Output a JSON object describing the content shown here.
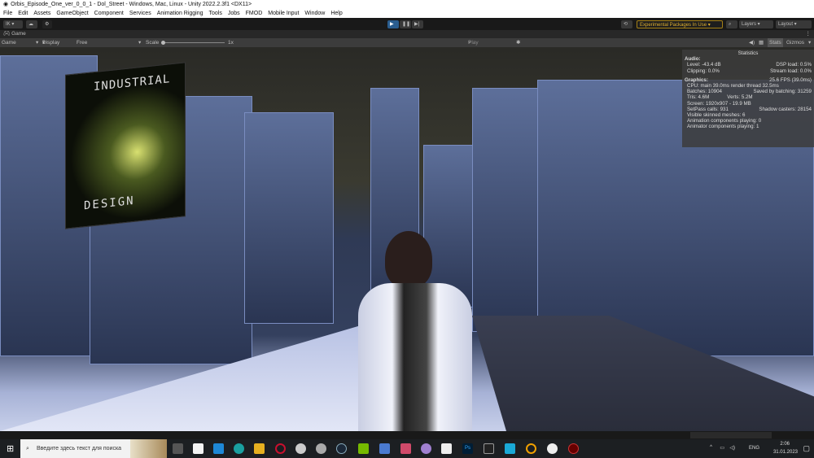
{
  "window": {
    "title": "Orbis_Episode_One_ver_0_0_1 - Dol_Street - Windows, Mac, Linux - Unity 2022.2.3f1 <DX11>"
  },
  "menu": [
    "File",
    "Edit",
    "Assets",
    "GameObject",
    "Component",
    "Services",
    "Animation Rigging",
    "Tools",
    "Jobs",
    "FMOD",
    "Mobile Input",
    "Window",
    "Help"
  ],
  "toolbar": {
    "account": "IK",
    "experimental": "Experimental Packages In Use ▾",
    "layers": "Layers",
    "layout": "Layout"
  },
  "game_tab": {
    "label": "Game"
  },
  "game_controls": {
    "mode": "Game",
    "display": "Display 1",
    "aspect": "Free Aspect",
    "scale_label": "Scale",
    "scale_value": "1x",
    "play_mode": "Play Maximized",
    "stats": "Stats",
    "gizmos": "Gizmos"
  },
  "scene_text": {
    "billboard_top": "INDUSTRIAL",
    "billboard_bottom": "DESIGN"
  },
  "stats": {
    "title": "Statistics",
    "audio": "Audio:",
    "level": "Level: -43.4 dB",
    "dsp": "DSP load: 0.5%",
    "clipping": "Clipping: 0.0%",
    "stream": "Stream load: 0.0%",
    "graphics": "Graphics:",
    "fps": "25.6 FPS (39.0ms)",
    "cpu": "CPU: main 39.0ms  render thread 32.5ms",
    "batches": "Batches: 10904",
    "saved": "Saved by batching: 31259",
    "tris": "Tris: 4.6M",
    "verts": "Verts: 5.2M",
    "screen": "Screen: 1920x907 - 19.9 MB",
    "setpass": "SetPass calls: 931",
    "shadow": "Shadow casters: 28154",
    "skinned": "Visible skinned meshes: 6",
    "anim": "Animation components playing: 0",
    "animator": "Animator components playing: 1"
  },
  "taskbar": {
    "search_placeholder": "Введите здесь текст для поиска",
    "lang": "ENG",
    "time": "2:06",
    "date": "31.01.2023"
  }
}
